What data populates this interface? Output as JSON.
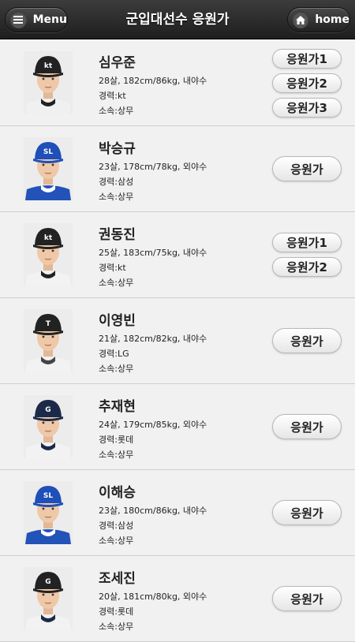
{
  "header": {
    "title": "군입대선수 응원가",
    "menu_label": "Menu",
    "home_label": "home",
    "menu_icon": "hamburger-icon",
    "home_icon": "house-icon"
  },
  "players": [
    {
      "name": "심우준",
      "info": "28살, 182cm/86kg, 내야수",
      "career": "경력:kt",
      "team": "소속:상무",
      "songs": [
        "응원가1",
        "응원가2",
        "응원가3"
      ],
      "cap": "#222222",
      "cap_logo": "kt",
      "jersey": "#f0f0f0",
      "collar": "#222222"
    },
    {
      "name": "박승규",
      "info": "23살, 178cm/78kg, 외야수",
      "career": "경력:삼성",
      "team": "소속:상무",
      "songs": [
        "응원가"
      ],
      "cap": "#1f4fb8",
      "cap_logo": "SL",
      "jersey": "#2352b8",
      "collar": "#ffffff"
    },
    {
      "name": "권동진",
      "info": "25살, 183cm/75kg, 내야수",
      "career": "경력:kt",
      "team": "소속:상무",
      "songs": [
        "응원가1",
        "응원가2"
      ],
      "cap": "#222222",
      "cap_logo": "kt",
      "jersey": "#f2f2f2",
      "collar": "#222222"
    },
    {
      "name": "이영빈",
      "info": "21살, 182cm/82kg, 내야수",
      "career": "경력:LG",
      "team": "소속:상무",
      "songs": [
        "응원가"
      ],
      "cap": "#222222",
      "cap_logo": "T",
      "jersey": "#f2f2f2",
      "collar": "#444444"
    },
    {
      "name": "추재현",
      "info": "24살, 179cm/85kg, 외야수",
      "career": "경력:롯데",
      "team": "소속:상무",
      "songs": [
        "응원가"
      ],
      "cap": "#1c2a4a",
      "cap_logo": "G",
      "jersey": "#f2f2f2",
      "collar": "#1c2a4a"
    },
    {
      "name": "이해승",
      "info": "23살, 180cm/86kg, 내야수",
      "career": "경력:삼성",
      "team": "소속:상무",
      "songs": [
        "응원가"
      ],
      "cap": "#1f4fb8",
      "cap_logo": "SL",
      "jersey": "#2352b8",
      "collar": "#ffffff"
    },
    {
      "name": "조세진",
      "info": "20살, 181cm/80kg, 외야수",
      "career": "경력:롯데",
      "team": "소속:상무",
      "songs": [
        "응원가"
      ],
      "cap": "#222222",
      "cap_logo": "G",
      "jersey": "#f2f2f2",
      "collar": "#1c2a4a"
    }
  ]
}
